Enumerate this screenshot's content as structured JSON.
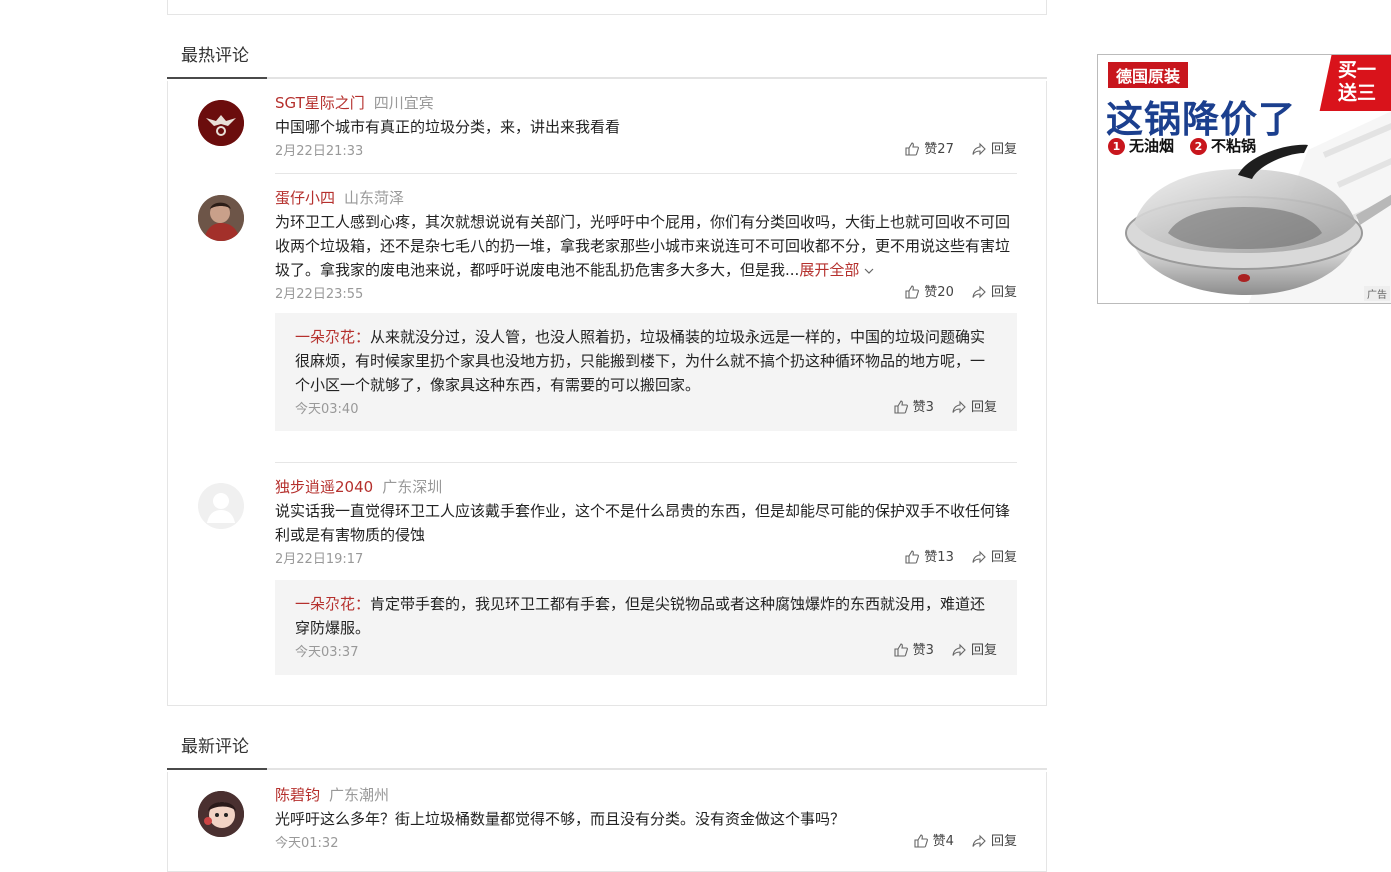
{
  "hot_section": {
    "title": "最热评论"
  },
  "new_section": {
    "title": "最新评论"
  },
  "actions": {
    "like_prefix": "赞",
    "reply_label": "回复"
  },
  "hot_comments": [
    {
      "user": "SGT星际之门",
      "location": "四川宜宾",
      "text": "中国哪个城市有真正的垃圾分类，来，讲出来我看看",
      "time": "2月22日21:33",
      "likes": "赞27"
    },
    {
      "user": "蛋仔小四",
      "location": "山东菏泽",
      "text": "为环卫工人感到心疼，其次就想说说有关部门，光呼吁中个屁用，你们有分类回收吗，大街上也就可回收不可回收两个垃圾箱，还不是杂七毛八的扔一堆，拿我老家那些小城市来说连可不可回收都不分，更不用说这些有害垃圾了。拿我家的废电池来说，都呼吁说废电池不能乱扔危害多大多大，但是我...",
      "expand": "展开全部",
      "time": "2月22日23:55",
      "likes": "赞20",
      "reply": {
        "user": "一朵尕花：",
        "text": "从来就没分过，没人管，也没人照着扔，垃圾桶装的垃圾永远是一样的，中国的垃圾问题确实很麻烦，有时候家里扔个家具也没地方扔，只能搬到楼下，为什么就不搞个扔这种循环物品的地方呢，一个小区一个就够了，像家具这种东西，有需要的可以搬回家。",
        "time": "今天03:40",
        "likes": "赞3"
      }
    },
    {
      "user": "独步逍遥2040",
      "location": "广东深圳",
      "text": "说实话我一直觉得环卫工人应该戴手套作业，这个不是什么昂贵的东西，但是却能尽可能的保护双手不收任何锋利或是有害物质的侵蚀",
      "time": "2月22日19:17",
      "likes": "赞13",
      "reply": {
        "user": "一朵尕花：",
        "text": "肯定带手套的，我见环卫工都有手套，但是尖锐物品或者这种腐蚀爆炸的东西就没用，难道还穿防爆服。",
        "time": "今天03:37",
        "likes": "赞3"
      }
    }
  ],
  "new_comments": [
    {
      "user": "陈碧钧",
      "location": "广东潮州",
      "text": "光呼吁这么多年？街上垃圾桶数量都觉得不够，而且没有分类。没有资金做这个事吗？",
      "time": "今天01:32",
      "likes": "赞4"
    }
  ],
  "ad": {
    "tag": "德国原装",
    "corner": "买一送三",
    "title": "这锅降价了",
    "feature1_num": "1",
    "feature1": "无油烟",
    "feature2_num": "2",
    "feature2": "不粘锅",
    "label": "广告"
  },
  "colors": {
    "username": "#b5302d",
    "ad_red": "#c8161d",
    "ad_blue": "#1b3f8e"
  }
}
